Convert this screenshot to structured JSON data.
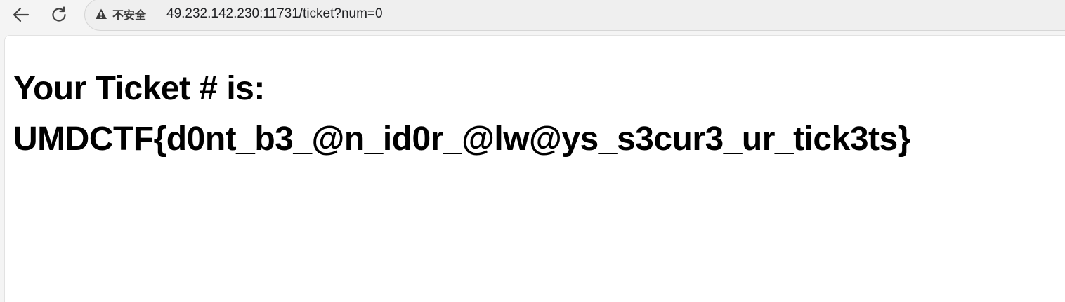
{
  "toolbar": {
    "back_icon": "arrow-left-icon",
    "reload_icon": "reload-icon"
  },
  "address_bar": {
    "security_icon": "warning-triangle-icon",
    "security_label": "不安全",
    "url": "49.232.142.230:11731/ticket?num=0"
  },
  "page": {
    "heading_line1": "Your Ticket # is:",
    "heading_line2": "UMDCTF{d0nt_b3_@n_id0r_@lw@ys_s3cur3_ur_tick3ts}"
  },
  "colors": {
    "chrome_background": "#f4f4f4",
    "omnibox_background": "#efefef",
    "page_background": "#ffffff",
    "text": "#000000"
  }
}
